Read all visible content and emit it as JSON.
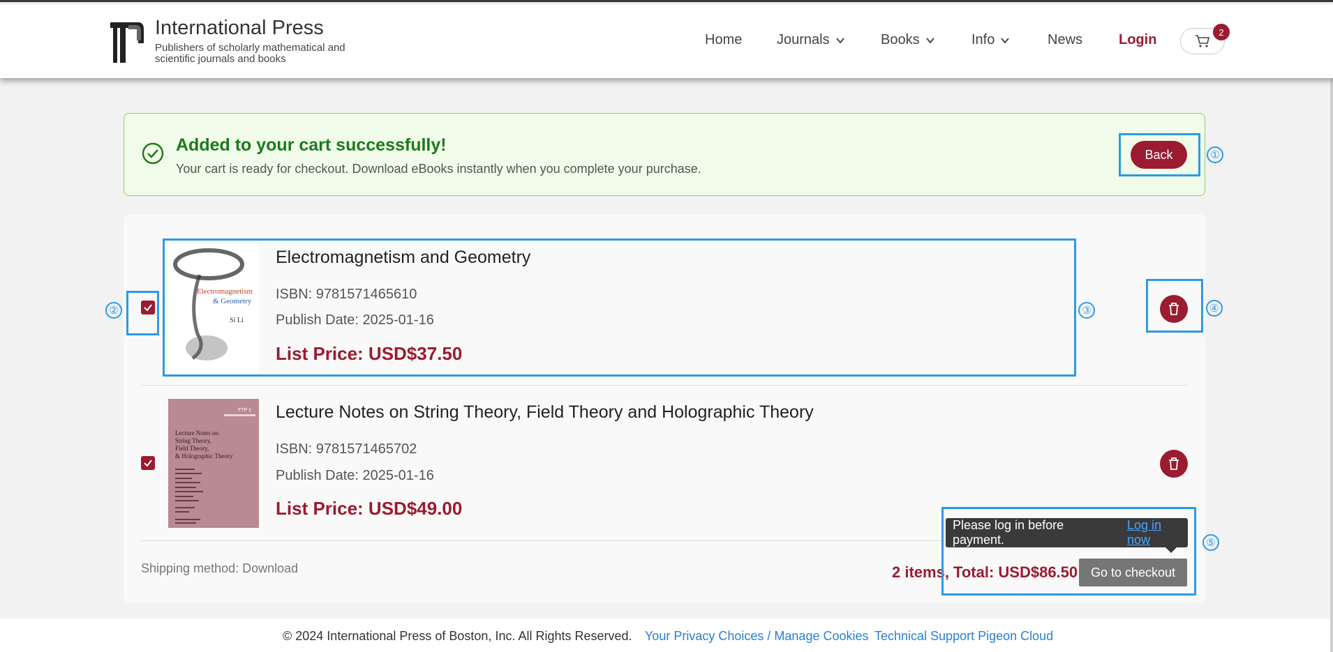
{
  "header": {
    "brand_title": "International Press",
    "brand_subtitle": "Publishers of scholarly mathematical and scientific journals and books",
    "nav": {
      "home": "Home",
      "journals": "Journals",
      "books": "Books",
      "info": "Info",
      "news": "News",
      "login": "Login"
    },
    "cart_count": "2"
  },
  "banner": {
    "title": "Added to your cart successfully!",
    "text": "Your cart is ready for checkout. Download eBooks instantly when you complete your purchase.",
    "back_label": "Back"
  },
  "cart": {
    "items": [
      {
        "title": "Electromagnetism and Geometry",
        "isbn": "ISBN: 9781571465610",
        "publish_date": "Publish Date: 2025-01-16",
        "price": "List Price: USD$37.50",
        "cover_title_1": "Electromagnetism",
        "cover_title_2": "& Geometry",
        "cover_author": "Si Li"
      },
      {
        "title": "Lecture Notes on String Theory, Field Theory and Holographic Theory",
        "isbn": "ISBN: 9781571465702",
        "publish_date": "Publish Date: 2025-01-16",
        "price": "List Price: USD$49.00",
        "cover_series": "FTP 1",
        "cover_title_1": "Lecture Notes on",
        "cover_title_2": "String Theory,",
        "cover_title_3": "Field Theory,",
        "cover_title_4": "& Holographic Theory"
      }
    ],
    "shipping": "Shipping method: Download",
    "total": "2 items, Total: USD$86.50",
    "checkout_label": "Go to checkout",
    "tooltip_text": "Please log in before payment.",
    "tooltip_link": "Log in now"
  },
  "footer": {
    "copyright": "© 2024 International Press of Boston, Inc. All Rights Reserved.",
    "privacy": "Your Privacy Choices / Manage Cookies",
    "support": "Technical Support Pigeon Cloud"
  },
  "annotations": [
    "①",
    "②",
    "③",
    "④",
    "⑤"
  ],
  "colors": {
    "accent": "#9b1b30",
    "success": "#1c7a1c",
    "annotation": "#2b9ae6"
  }
}
